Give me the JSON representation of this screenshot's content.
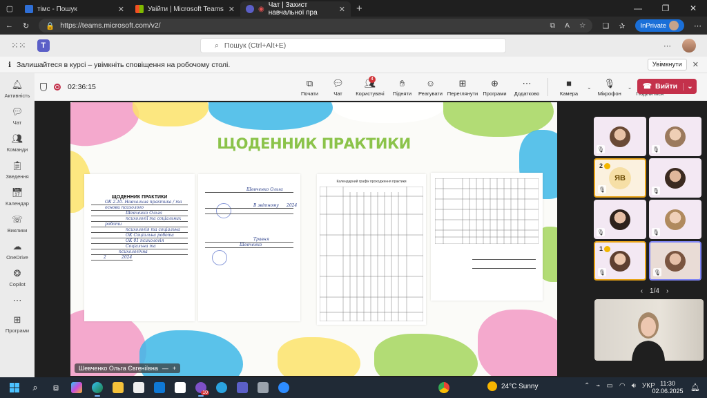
{
  "browser": {
    "tabs": [
      {
        "label": "тімс - Пошук",
        "active": false
      },
      {
        "label": "Увійти | Microsoft Teams",
        "active": false
      },
      {
        "label": "Чат | Захист навчальної пра",
        "active": true
      }
    ],
    "url": "https://teams.microsoft.com/v2/",
    "inprivate": "InPrivate"
  },
  "teams": {
    "search_placeholder": "Пошук (Ctrl+Alt+E)"
  },
  "banner": {
    "text": "Залишайтеся в курсі – увімкніть сповіщення на робочому столі.",
    "button": "Увімкнути"
  },
  "rail": [
    {
      "label": "Активність",
      "icon": "bell-icon"
    },
    {
      "label": "Чат",
      "icon": "chat-icon"
    },
    {
      "label": "Команди",
      "icon": "teams-icon"
    },
    {
      "label": "Зведення",
      "icon": "clipboard-icon"
    },
    {
      "label": "Календар",
      "icon": "calendar-icon"
    },
    {
      "label": "Виклики",
      "icon": "phone-icon"
    },
    {
      "label": "OneDrive",
      "icon": "cloud-icon"
    },
    {
      "label": "Copilot",
      "icon": "copilot-icon"
    },
    {
      "label": "Програми",
      "icon": "add-app-icon"
    }
  ],
  "meeting": {
    "timer": "02:36:15",
    "tools": [
      {
        "label": "Почати",
        "icon": "share-icon"
      },
      {
        "label": "Чат",
        "icon": "chat-icon"
      },
      {
        "label": "Користувачі",
        "icon": "people-icon",
        "badge": "4"
      },
      {
        "label": "Підняти",
        "icon": "hand-icon"
      },
      {
        "label": "Реагувати",
        "icon": "emoji-icon"
      },
      {
        "label": "Переглянути",
        "icon": "view-icon"
      },
      {
        "label": "Програми",
        "icon": "apps-icon"
      },
      {
        "label": "Додатково",
        "icon": "more-icon"
      }
    ],
    "camera": "Камера",
    "mic": "Мікрофон",
    "share": "Поділитися",
    "leave": "Вийти",
    "presenter": "Шевченко Ольга Євгеніївна",
    "pager": "1/4"
  },
  "slide": {
    "title": "ЩОДЕННИК ПРАКТИКИ",
    "page1_header": "ЩОДЕННИК ПРАКТИКИ",
    "page1_lines": [
      "ОК 2.10. Навчальна практика / та",
      "основи психолого",
      "Шевченко Ольга",
      "психології та соціальних",
      "роботи",
      "психологія та соціальна",
      "ОК Соціальна робота",
      "ОК 01 психологія",
      "Соціальна та",
      "психологічна",
      "2",
      "2024"
    ],
    "page2_lines": [
      "Шевченко Ольга",
      "В звітному",
      "2024",
      "Шевченко",
      "Травня"
    ],
    "page3_header": "Календарний графік проходження практики"
  },
  "participants": [
    {
      "initials": "",
      "number": ""
    },
    {
      "initials": "",
      "number": ""
    },
    {
      "initials": "ЯВ",
      "number": "2"
    },
    {
      "initials": "",
      "number": ""
    },
    {
      "initials": "",
      "number": ""
    },
    {
      "initials": "",
      "number": ""
    },
    {
      "initials": "",
      "number": "1"
    },
    {
      "initials": "",
      "number": ""
    }
  ],
  "taskbar": {
    "weather": "24°C  Sunny",
    "lang": "УКР",
    "time": "11:30",
    "date": "02.06.2025",
    "badge": "10"
  }
}
